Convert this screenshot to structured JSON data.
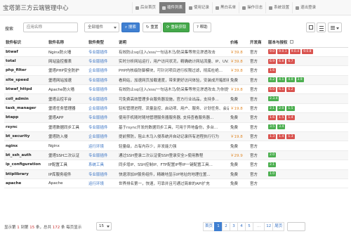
{
  "app": {
    "title": "宝塔第三方云端管理中心"
  },
  "nav": [
    {
      "label": "后台首页",
      "active": false
    },
    {
      "label": "插件列表",
      "active": true
    },
    {
      "label": "使用记录",
      "active": false
    },
    {
      "label": "黑白名单",
      "active": false
    },
    {
      "label": "操作日志",
      "active": false
    },
    {
      "label": "系统设置",
      "active": false
    },
    {
      "label": "退出登录",
      "active": false
    }
  ],
  "toolbar": {
    "search_label": "搜索",
    "search_placeholder": "应用名称",
    "filter_value": "全部插件",
    "search_button": "搜索",
    "reset_button": "重置",
    "refresh_button": "重新获取",
    "help_button": "帮助"
  },
  "table": {
    "headers": [
      "软件标识",
      "软件名称",
      "软件类型",
      "说明",
      "价格",
      "开发商",
      "版本与授权"
    ],
    "rows": [
      {
        "id": "btwaf",
        "name": "Nginx防火墙",
        "type": "专业版插件",
        "desc": "有效防止sql注入/xss/一句话木马/防采集等常见渗透攻击",
        "price": "￥39.8",
        "dev": "官方",
        "versions": [
          [
            "9.0",
            "red"
          ],
          [
            "9.0.1",
            "red"
          ],
          [
            "9.0.4",
            "red"
          ],
          [
            "9.0.8",
            "red"
          ]
        ]
      },
      {
        "id": "total",
        "name": "网站监控报表",
        "type": "专业版插件",
        "desc": "实时分析网站运行，用户访问状况，精确统计网站流量、IP、UV...",
        "price": "￥39.8",
        "dev": "官方",
        "versions": [
          [
            "6.9",
            "red"
          ],
          [
            "6.8",
            "red"
          ],
          [
            "6.7",
            "red"
          ]
        ]
      },
      {
        "id": "php_filter",
        "name": "堡塔PHP安全防护",
        "type": "企业版插件",
        "desc": "PHP内核级防御模块，可针对项目进行权限过滤，彻底杜绝...",
        "price": "￥39.8",
        "dev": "官方",
        "versions": [
          [
            "1.6",
            "red"
          ]
        ]
      },
      {
        "id": "site_speed",
        "name": "堡塔网站加速",
        "type": "专业版插件",
        "desc": "看网站，加速网页加载速度，带来更好访问体验，安装成开箱即用...",
        "price": "免费",
        "dev": "官方",
        "versions": [
          [
            "4.2",
            "green"
          ],
          [
            "4.1",
            "green"
          ],
          [
            "4.0",
            "green"
          ],
          [
            "3.9",
            "green"
          ]
        ]
      },
      {
        "id": "btwaf_httpd",
        "name": "Apache防火墙",
        "type": "专业版插件",
        "desc": "有效防止sql注入/xss/一句话木马/防采集等常见渗透攻击,为你提供...",
        "price": "￥19.8",
        "dev": "官方",
        "versions": [
          [
            "6.0",
            "red"
          ],
          [
            "6.1",
            "red"
          ],
          [
            "6.2",
            "red"
          ]
        ]
      },
      {
        "id": "coll_admin",
        "name": "堡塔云控平台",
        "type": "专业版插件",
        "desc": "可免费高效管理多台服务器设施，官方行业出品，支持多...",
        "price": "免费",
        "dev": "官方",
        "versions": [
          [
            "2.3.4",
            "green"
          ]
        ]
      },
      {
        "id": "task_manager",
        "name": "堡塔任务管理器",
        "type": "企业版插件",
        "desc": "轻松管理进程、流量监控、启动项、用户、服务、计划任务、会话...",
        "price": "￥19.8",
        "dev": "官方",
        "versions": [
          [
            "2.1",
            "green"
          ],
          [
            "2.0",
            "green"
          ],
          [
            "1.5",
            "green"
          ]
        ]
      },
      {
        "id": "btapp",
        "name": "堡塔APP",
        "type": "专业版插件",
        "desc": "使用手机随时随地管理服务器服务器, 支持查看服务器...",
        "price": "免费",
        "dev": "官方",
        "versions": [
          [
            "1.6",
            "red"
          ],
          [
            "1.5",
            "red"
          ],
          [
            "1.4",
            "red"
          ]
        ]
      },
      {
        "id": "rsync",
        "name": "堡塔数据同步工具",
        "type": "专业版插件",
        "desc": "基于rsync开发的数据同步工具，可用于异地备份，多台...",
        "price": "免费",
        "dev": "官方",
        "versions": [
          [
            "3.5",
            "green"
          ],
          [
            "3.4",
            "green"
          ]
        ]
      },
      {
        "id": "bt_security",
        "name": "堡塔防入侵",
        "type": "企业版插件",
        "desc": "提前预防，阻止木马入侵系统并自动记录所有进程执行行为",
        "price": "￥19.8",
        "dev": "官方",
        "versions": [
          [
            "1.3",
            "red"
          ],
          [
            "1.4",
            "red"
          ],
          [
            "1.3",
            "red"
          ]
        ]
      },
      {
        "id": "nginx",
        "name": "Nginx",
        "type": "运行环境",
        "desc": "轻量级，占有内存少，并发能力强",
        "price": "免费",
        "dev": "官方",
        "versions": []
      },
      {
        "id": "bt_ssh_auth",
        "name": "堡塔SSH二次认证",
        "type": "专业版插件",
        "desc": "通过SSH登录二次认证使SSH登录安全>使用教程",
        "price": "￥29.9",
        "dev": "官方",
        "versions": [
          [
            "2.0",
            "green"
          ]
        ]
      },
      {
        "id": "ip_configuration",
        "name": "IP配置工具",
        "type": "系统工具",
        "desc": "同步增IP、SSH控制IP、FTP配置IP等IP一键配置工具...",
        "price": "免费",
        "dev": "官方",
        "versions": [
          [
            "2.1",
            "green"
          ]
        ]
      },
      {
        "id": "btiplibrary",
        "name": "IP库服务组件",
        "type": "专业版插件",
        "desc": "快速添加IP服务组件，精确地显示IP地址的地理位置...",
        "price": "免费",
        "dev": "官方",
        "versions": [
          [
            "1.0",
            "green"
          ]
        ]
      },
      {
        "id": "apache",
        "name": "Apache",
        "type": "运行环境",
        "desc": "世界排名第一，快速，可靠并且可通过简单的API扩充",
        "price": "免费",
        "dev": "官方",
        "versions": []
      }
    ]
  },
  "footer": {
    "prefix": "显示第",
    "from": "1",
    "mid1": "到第",
    "to": "15",
    "mid2": "条，总共",
    "total": "172",
    "suffix": "条 每页显示",
    "per_page": "15",
    "pages": [
      "首页",
      "1",
      "2",
      "3",
      "4",
      "5",
      "...",
      "12",
      "尾页"
    ]
  }
}
